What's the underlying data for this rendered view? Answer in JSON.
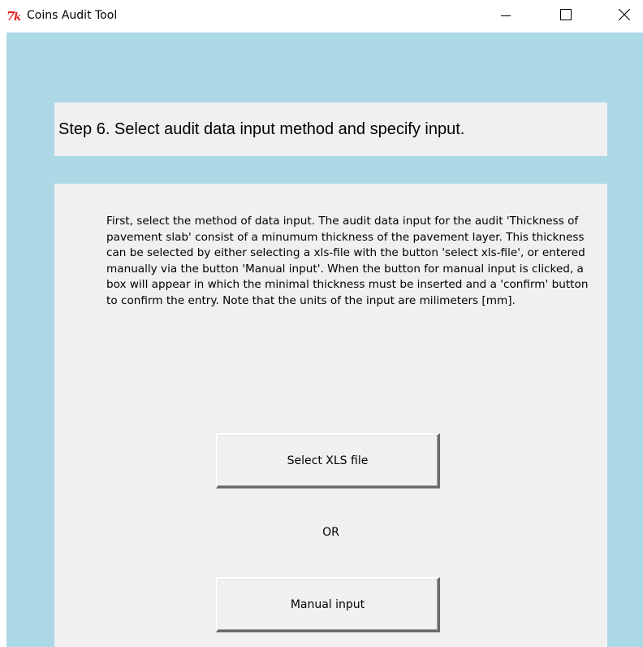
{
  "window": {
    "title": "Coins Audit Tool",
    "icon": "tk-feather-icon",
    "controls": {
      "minimize": "minimize-icon",
      "maximize": "maximize-icon",
      "close": "close-icon"
    }
  },
  "step": {
    "title": "Step 6. Select audit data input method and specify input."
  },
  "instructions": {
    "text": "First, select the method of data input. The audit data input for the audit 'Thickness of pavement slab' consist of a minumum thickness of the pavement layer. This thickness can be selected by either selecting a xls-file with the button 'select xls-file', or entered manually via the button 'Manual input'. When the button for manual input is clicked, a box will appear in which the minimal thickness must be inserted and a 'confirm' button to confirm the entry. Note that the units of the input are milimeters [mm]."
  },
  "buttons": {
    "select_xls": "Select XLS file",
    "or_label": "OR",
    "manual_input": "Manual input"
  },
  "colors": {
    "background": "#add8e6",
    "panel": "#f0f0f0",
    "tk_icon": "#e51c1c"
  }
}
